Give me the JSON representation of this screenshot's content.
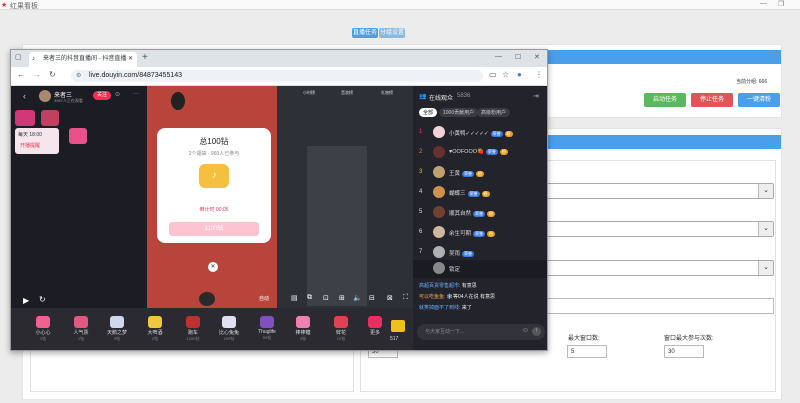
{
  "app": {
    "title": "红果看板",
    "minimize": "—",
    "restore": "❐",
    "close": "✕"
  },
  "segments": [
    "直播任务",
    "分组设置"
  ],
  "buttons": {
    "start": "启动任务",
    "stop": "停止任务",
    "clean": "一键清粉"
  },
  "stat": "当前分组: 666",
  "fields": {
    "min_window_label": "最大窗口数:",
    "min_window_value": "5",
    "fans_label": "窗口最大参与次数:",
    "fans_value": "30",
    "left_value": "30"
  },
  "browser": {
    "tab_title": "来者三的抖音直播间 - 抖音直播",
    "new_tab": "+",
    "url": "live.douyin.com/84873455143",
    "controls": {
      "min": "—",
      "max": "☐",
      "close": "✕"
    }
  },
  "live": {
    "streamer_name": "来者三",
    "streamer_sub": "3567人正在观看",
    "follow": "关注",
    "top_tag": "每天 18:00",
    "top_tag2": "开播提醒",
    "lucky_title": "总100钻",
    "lucky_sub": "2个福袋 · 960人已参与",
    "countdown": "倒计时 00:05",
    "join_btn": "1100钻",
    "ctrl_label": "自动",
    "gifts": [
      {
        "name": "小心心",
        "price": "1钻"
      },
      {
        "name": "人气票",
        "price": "1钻"
      },
      {
        "name": "天鹅之梦",
        "price": "9钻"
      },
      {
        "name": "大啤酒",
        "price": "2钻"
      },
      {
        "name": "跑车",
        "price": "1200钻"
      },
      {
        "name": "比心兔兔",
        "price": "299钻"
      },
      {
        "name": "Thuglife",
        "price": "99钻"
      },
      {
        "name": "棒棒糖",
        "price": "9钻"
      },
      {
        "name": "鲜花",
        "price": "10钻"
      },
      {
        "name": "更多",
        "price": ""
      }
    ],
    "diamond": "517"
  },
  "viewers": {
    "title": "在线观众",
    "count": "5836",
    "tabs": [
      "全部",
      "1000贡献用户",
      "高级粉用户"
    ],
    "rows": [
      {
        "rank": "1",
        "name": "小黄鸭✓✓✓✓✓"
      },
      {
        "rank": "2",
        "name": "♥OOFOOO🍓"
      },
      {
        "rank": "3",
        "name": "王黄"
      },
      {
        "rank": "4",
        "name": "蝴蝶三"
      },
      {
        "rank": "5",
        "name": "顺其自然"
      },
      {
        "rank": "6",
        "name": "余生可期"
      },
      {
        "rank": "7",
        "name": "吴雨"
      },
      {
        "rank": "",
        "name": "锁定"
      }
    ],
    "comments": [
      {
        "user": "高超百货零售超市:",
        "text": "有意思"
      },
      {
        "user": "可以吃鱼鱼:",
        "text": "❄️等04人在说 有意思"
      },
      {
        "user": "就笑掉面不了到线:",
        "text": "来了"
      }
    ],
    "chat_placeholder": "与大家互动一下..."
  }
}
